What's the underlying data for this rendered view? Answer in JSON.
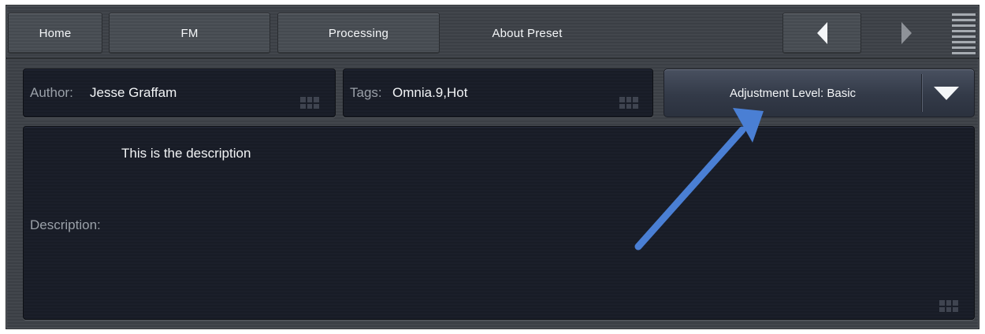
{
  "nav": {
    "home_label": "Home",
    "fm_label": "FM",
    "processing_label": "Processing",
    "about_label": "About Preset"
  },
  "author": {
    "label": "Author:",
    "value": "Jesse Graffam"
  },
  "tags": {
    "label": "Tags:",
    "value": "Omnia.9,Hot"
  },
  "adjustment": {
    "label": "Adjustment Level: Basic"
  },
  "description": {
    "label": "Description:",
    "value": "This is the description"
  },
  "icons": {
    "prev": "triangle-left-icon",
    "next": "triangle-right-icon",
    "menu": "menu-lines-icon",
    "grip": "keypad-grip-icon",
    "dropdown": "chevron-down-icon"
  },
  "colors": {
    "annotation_arrow": "#4a7fd4",
    "panel_bg": "#1b1f2a",
    "frame_bg": "#42464c"
  }
}
